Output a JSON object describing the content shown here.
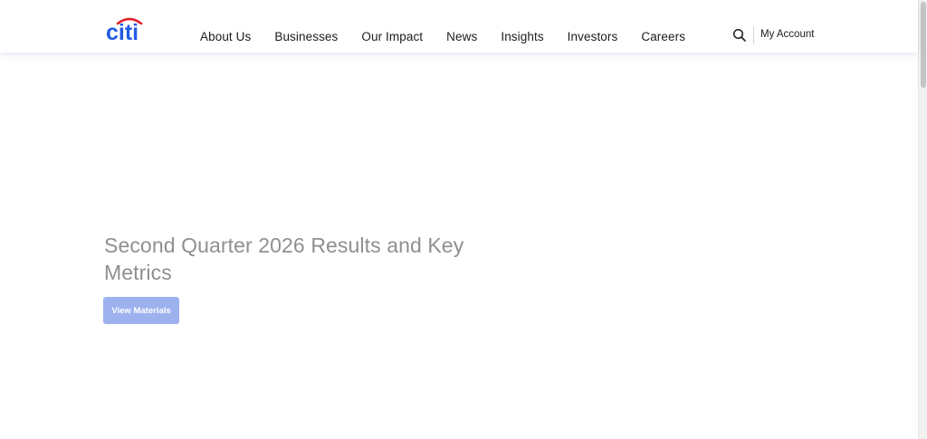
{
  "header": {
    "logo_text": "citi",
    "nav": [
      "About Us",
      "Businesses",
      "Our Impact",
      "News",
      "Insights",
      "Investors",
      "Careers"
    ],
    "account_label": "My Account"
  },
  "hero": {
    "title": "Second Quarter 2026 Results and Key Metrics",
    "cta_label": "View Materials"
  },
  "colors": {
    "brand_blue": "#255be3",
    "brand_red": "#e51f2d",
    "cta_bg": "#9db1ee",
    "title_gray": "#8f8f8f"
  },
  "icons": {
    "search": "search-icon"
  }
}
